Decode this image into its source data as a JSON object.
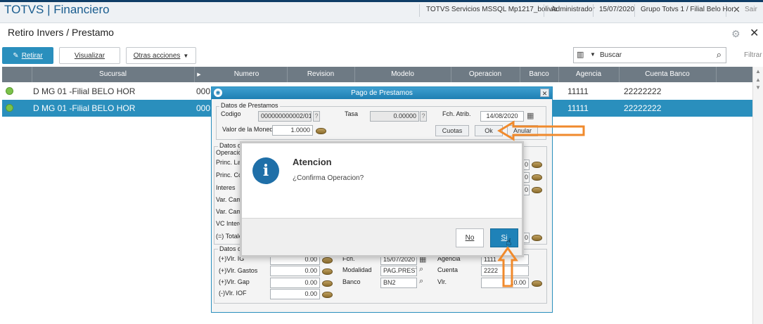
{
  "topbar": {
    "brand": "TOTVS | Financiero",
    "environment": "TOTVS Servicios MSSQL Mp1217_bolivia",
    "user": "Administrador",
    "date": "15/07/2020",
    "branch": "Grupo Totvs 1 / Filial Belo Hor",
    "exit_label": "Sair"
  },
  "page": {
    "title": "Retiro Invers / Prestamo"
  },
  "toolbar": {
    "retirar": "Retirar",
    "visualizar": "Visualizar",
    "otras_acciones": "Otras acciones",
    "search_placeholder": "Buscar",
    "filtrar": "Filtrar"
  },
  "grid": {
    "columns": [
      "Sucursal",
      "Numero",
      "Revision",
      "Modelo",
      "Operacion",
      "Banco",
      "Agencia",
      "Cuenta Banco"
    ],
    "rows": [
      {
        "sucursal": "D MG 01 -Filial BELO HOR",
        "numero": "000",
        "agencia": "11111",
        "cuenta": "22222222",
        "selected": false
      },
      {
        "sucursal": "D MG 01 -Filial BELO HOR",
        "numero": "000",
        "agencia": "11111",
        "cuenta": "22222222",
        "selected": true
      }
    ]
  },
  "dialog": {
    "title": "Pago de Prestamos",
    "grp_prestamos": "Datos de Prestamos",
    "codigo_label": "Codigo",
    "codigo_value": "000000000002/01",
    "tasa_label": "Tasa",
    "tasa_value": "0.00000",
    "fch_label": "Fch. Atrib.",
    "fch_value": "14/08/2020",
    "valor_moneda_label": "Valor de la Moneda",
    "valor_moneda_value": "1.0000",
    "cuotas_btn": "Cuotas",
    "ok_btn": "Ok",
    "anular_btn": "Anular",
    "grp2_label": "Datos d",
    "operacion_label": "Operacio",
    "princ_la": "Princ. La",
    "princ_co": "Princ. Co",
    "interes": "Interes",
    "var_cam1": "Var. Cam",
    "var_cam2": "Var. Cam",
    "vc_interes": "VC Intere",
    "totales": "(=) Totale",
    "right_vals": [
      "0",
      "0",
      "0",
      "0"
    ],
    "grp3_label": "Datos d",
    "vlr_ig_label": "(+)Vlr. IG",
    "vlr_ig": "0.00",
    "vlr_gastos_label": "(+)Vlr. Gastos",
    "vlr_gastos": "0.00",
    "vlr_gap_label": "(+)Vlr. Gap",
    "vlr_gap": "0.00",
    "vlr_iof_label": "(-)Vlr. IOF",
    "vlr_iof": "0.00",
    "fch_label2": "Fch.",
    "fch2_value": "15/07/2020",
    "modalidad_label": "Modalidad",
    "modalidad_value": "PAG.PREST.",
    "banco_label": "Banco",
    "banco_value": "BN2",
    "agencia_label": "Agencia",
    "agencia_value": "1111",
    "cuenta_label": "Cuenta",
    "cuenta_value": "2222",
    "vlr_label": "Vlr.",
    "vlr_value": "10.00"
  },
  "modal": {
    "title": "Atencion",
    "message": "¿Confirma Operacion?",
    "no_btn": "No",
    "si_btn": "Si"
  },
  "colors": {
    "accent": "#2a8fbd",
    "annotation": "#f08a2c",
    "status_ok": "#7cc24a"
  }
}
